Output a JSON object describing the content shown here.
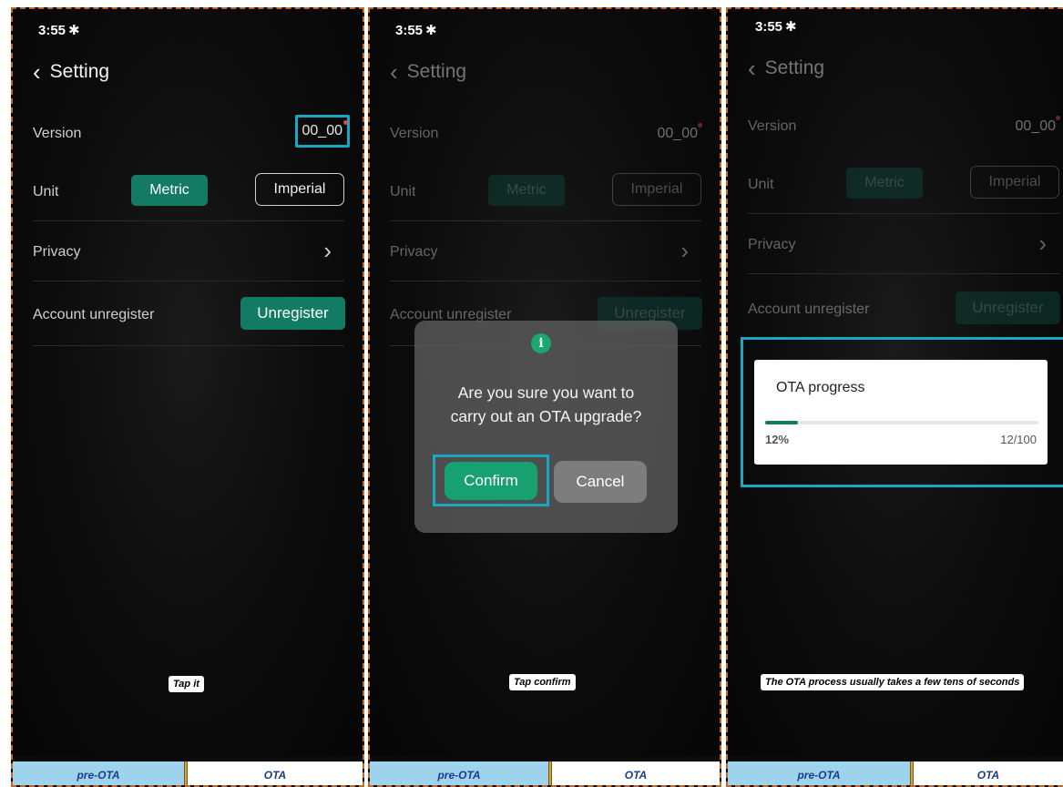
{
  "panels": [
    {
      "status_time": "3:55",
      "status_icon": "bluetooth-icon",
      "header_title": "Setting",
      "version_label": "Version",
      "version_value": "00_00",
      "unit_label": "Unit",
      "metric_label": "Metric",
      "imperial_label": "Imperial",
      "privacy_label": "Privacy",
      "account_label": "Account unregister",
      "unregister_label": "Unregister",
      "caption": "Tap it",
      "tab_pre": "pre-OTA",
      "tab_ota": "OTA"
    },
    {
      "status_time": "3:55",
      "status_icon": "bluetooth-icon",
      "header_title": "Setting",
      "version_label": "Version",
      "version_value": "00_00",
      "unit_label": "Unit",
      "metric_label": "Metric",
      "imperial_label": "Imperial",
      "privacy_label": "Privacy",
      "account_label": "Account unregister",
      "unregister_label": "Unregister",
      "dialog": {
        "icon": "info-icon",
        "message_line1": "Are you sure you want to",
        "message_line2": "carry out an OTA upgrade?",
        "confirm_label": "Confirm",
        "cancel_label": "Cancel"
      },
      "caption": "Tap confirm",
      "tab_pre": "pre-OTA",
      "tab_ota": "OTA"
    },
    {
      "status_time": "3:55",
      "status_icon": "bluetooth-icon",
      "header_title": "Setting",
      "version_label": "Version",
      "version_value": "00_00",
      "unit_label": "Unit",
      "metric_label": "Metric",
      "imperial_label": "Imperial",
      "privacy_label": "Privacy",
      "account_label": "Account unregister",
      "unregister_label": "Unregister",
      "ota": {
        "title": "OTA progress",
        "percent_label": "12%",
        "count_label": "12/100",
        "progress_fraction": 0.12
      },
      "caption": "The OTA process usually takes a few tens of seconds",
      "tab_pre": "pre-OTA",
      "tab_ota": "OTA"
    }
  ],
  "colors": {
    "accent_green": "#137a63",
    "highlight_cyan": "#1ba7c2",
    "border_dashed": "#c0692a",
    "tab_blue": "#9ed3ee",
    "notification_dot": "#e24848"
  }
}
